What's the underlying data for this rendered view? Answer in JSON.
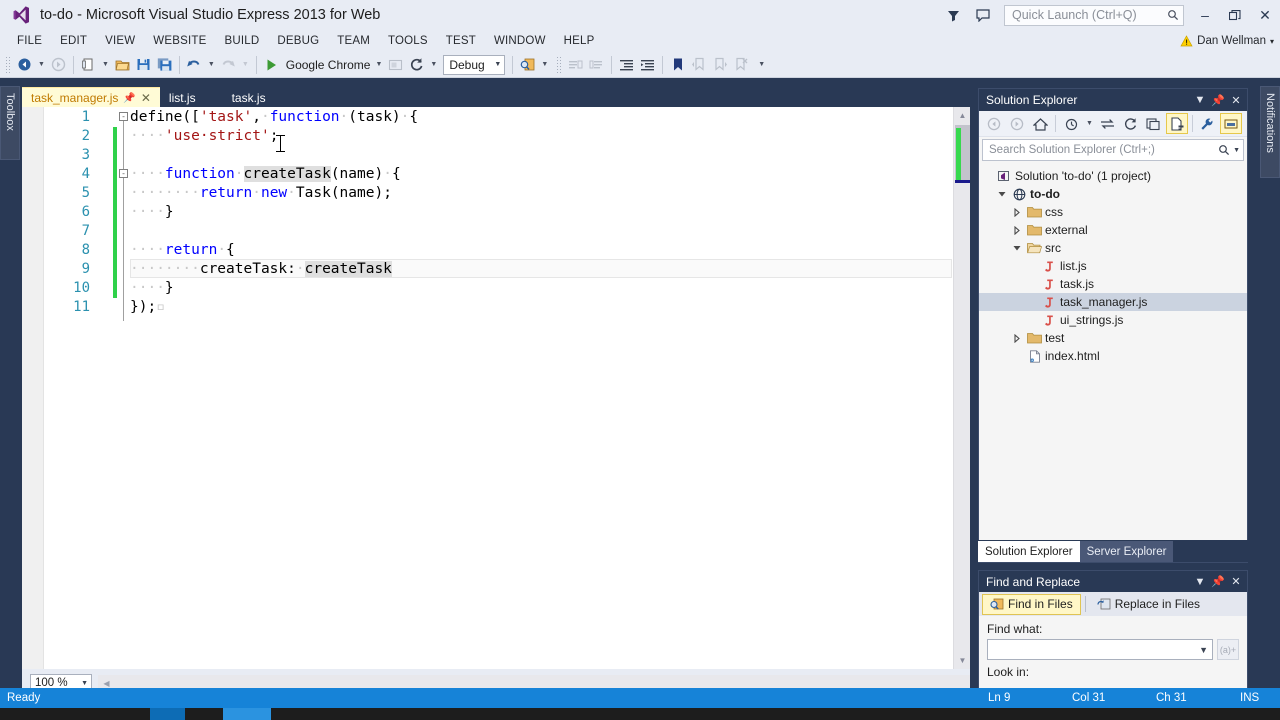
{
  "titlebar": {
    "title": "to-do - Microsoft Visual Studio Express 2013 for Web",
    "logo_icon": "visual-studio-logo",
    "feedback_icon": "feedback-funnel-icon",
    "comment_icon": "comment-icon",
    "quick_launch_placeholder": "Quick Launch (Ctrl+Q)",
    "search_icon": "search-icon",
    "minimize": "–",
    "maximize": "❐",
    "close": "✕"
  },
  "menubar": {
    "items": [
      {
        "label": "FILE"
      },
      {
        "label": "EDIT"
      },
      {
        "label": "VIEW"
      },
      {
        "label": "WEBSITE"
      },
      {
        "label": "BUILD"
      },
      {
        "label": "DEBUG"
      },
      {
        "label": "TEAM"
      },
      {
        "label": "TOOLS"
      },
      {
        "label": "TEST"
      },
      {
        "label": "WINDOW"
      },
      {
        "label": "HELP"
      }
    ],
    "user": {
      "name": "Dan Wellman",
      "warning_icon": "warning-triangle-icon",
      "caret": "▾"
    }
  },
  "toolbar": {
    "navigate_back_icon": "navigate-back-icon",
    "navigate_forward_icon": "navigate-forward-icon",
    "new_item_icon": "new-item-icon",
    "open_file_icon": "open-file-icon",
    "save_icon": "save-icon",
    "save_all_icon": "save-all-icon",
    "undo_icon": "undo-icon",
    "redo_icon": "redo-icon",
    "start_debug_icon": "play-icon",
    "start_label": "Google Chrome",
    "browser_picker_icon": "browser-picker-icon",
    "refresh_icon": "refresh-linked-icon",
    "config": "Debug",
    "find_icon": "find-in-files-icon",
    "comment_out_icon": "comment-out-icon",
    "uncomment_icon": "uncomment-icon",
    "indent_icon": "increase-indent-icon",
    "outdent_icon": "decrease-indent-icon",
    "bookmark_icon": "bookmark-icon",
    "prev_bookmark_icon": "previous-bookmark-icon",
    "next_bookmark_icon": "next-bookmark-icon",
    "clear_bookmarks_icon": "clear-bookmarks-icon",
    "overflow": "⮟"
  },
  "left_dock": {
    "toolbox_label": "Toolbox"
  },
  "right_dock": {
    "notifications_label": "Notifications"
  },
  "editor": {
    "tabs": [
      {
        "label": "task_manager.js",
        "active": true,
        "pin_icon": "pin-icon",
        "close_icon": "close-icon"
      },
      {
        "label": "list.js",
        "active": false
      },
      {
        "label": "task.js",
        "active": false
      }
    ],
    "zoom": "100 %",
    "zoom_caret": "▾",
    "lines": [
      {
        "num": "1",
        "fold": "-",
        "changed": false,
        "current": false,
        "tokens": [
          {
            "t": "define([",
            "c": "plain"
          },
          {
            "t": "'task'",
            "c": "str"
          },
          {
            "t": ",",
            "c": "plain"
          },
          {
            "t": "·",
            "c": "ws"
          },
          {
            "t": "function",
            "c": "kw"
          },
          {
            "t": "·",
            "c": "ws"
          },
          {
            "t": "(task)",
            "c": "plain"
          },
          {
            "t": "·",
            "c": "ws"
          },
          {
            "t": "{",
            "c": "plain"
          }
        ]
      },
      {
        "num": "2",
        "fold": "",
        "changed": true,
        "current": false,
        "tokens": [
          {
            "t": "····",
            "c": "ws"
          },
          {
            "t": "'use·strict'",
            "c": "str"
          },
          {
            "t": ";",
            "c": "plain"
          }
        ]
      },
      {
        "num": "3",
        "fold": "",
        "changed": true,
        "current": false,
        "tokens": []
      },
      {
        "num": "4",
        "fold": "-",
        "changed": true,
        "current": false,
        "tokens": [
          {
            "t": "····",
            "c": "ws"
          },
          {
            "t": "function",
            "c": "kw"
          },
          {
            "t": "·",
            "c": "ws"
          },
          {
            "t": "createTask",
            "c": "hl"
          },
          {
            "t": "(name)",
            "c": "plain"
          },
          {
            "t": "·",
            "c": "ws"
          },
          {
            "t": "{",
            "c": "plain"
          }
        ]
      },
      {
        "num": "5",
        "fold": "",
        "changed": true,
        "current": false,
        "tokens": [
          {
            "t": "········",
            "c": "ws"
          },
          {
            "t": "return",
            "c": "kw"
          },
          {
            "t": "·",
            "c": "ws"
          },
          {
            "t": "new",
            "c": "kw"
          },
          {
            "t": "·",
            "c": "ws"
          },
          {
            "t": "Task(name);",
            "c": "plain"
          }
        ]
      },
      {
        "num": "6",
        "fold": "",
        "changed": true,
        "current": false,
        "tokens": [
          {
            "t": "····",
            "c": "ws"
          },
          {
            "t": "}",
            "c": "plain"
          }
        ]
      },
      {
        "num": "7",
        "fold": "",
        "changed": true,
        "current": false,
        "tokens": []
      },
      {
        "num": "8",
        "fold": "",
        "changed": true,
        "current": false,
        "tokens": [
          {
            "t": "····",
            "c": "ws"
          },
          {
            "t": "return",
            "c": "kw"
          },
          {
            "t": "·",
            "c": "ws"
          },
          {
            "t": "{",
            "c": "plain"
          }
        ]
      },
      {
        "num": "9",
        "fold": "",
        "changed": true,
        "current": true,
        "tokens": [
          {
            "t": "········",
            "c": "ws"
          },
          {
            "t": "createTask:",
            "c": "plain"
          },
          {
            "t": "·",
            "c": "ws"
          },
          {
            "t": "createTask",
            "c": "hl"
          }
        ]
      },
      {
        "num": "10",
        "fold": "",
        "changed": true,
        "current": false,
        "tokens": [
          {
            "t": "····",
            "c": "ws"
          },
          {
            "t": "}",
            "c": "plain"
          }
        ]
      },
      {
        "num": "11",
        "fold": "",
        "changed": false,
        "current": false,
        "tokens": [
          {
            "t": "});",
            "c": "plain"
          },
          {
            "t": "▫",
            "c": "ws"
          }
        ]
      }
    ]
  },
  "solution_explorer": {
    "title": "Solution Explorer",
    "dropdown_icon": "chevron-down-icon",
    "pin_icon": "pin-icon",
    "close_icon": "close-icon",
    "toolbar_icons": [
      "back-icon",
      "forward-icon",
      "home-icon",
      "pending-changes-icon",
      "sync-with-active-document-icon",
      "refresh-icon",
      "collapse-all-icon",
      "show-all-files-icon",
      "properties-icon",
      "preview-selected-items-icon"
    ],
    "search_placeholder": "Search Solution Explorer (Ctrl+;)",
    "search_icon": "search-icon",
    "search_caret": "▾",
    "tree": [
      {
        "label": "Solution 'to-do' (1 project)",
        "icon": "solution-icon",
        "indent": 0,
        "expander": "",
        "bold": false,
        "selected": false
      },
      {
        "label": "to-do",
        "icon": "web-project-icon",
        "indent": 1,
        "expander": "expanded",
        "bold": true,
        "selected": false
      },
      {
        "label": "css",
        "icon": "folder-icon",
        "indent": 2,
        "expander": "collapsed",
        "bold": false,
        "selected": false
      },
      {
        "label": "external",
        "icon": "folder-icon",
        "indent": 2,
        "expander": "collapsed",
        "bold": false,
        "selected": false
      },
      {
        "label": "src",
        "icon": "folder-open-icon",
        "indent": 2,
        "expander": "expanded",
        "bold": false,
        "selected": false
      },
      {
        "label": "list.js",
        "icon": "js-file-icon",
        "indent": 3,
        "expander": "",
        "bold": false,
        "selected": false
      },
      {
        "label": "task.js",
        "icon": "js-file-icon",
        "indent": 3,
        "expander": "",
        "bold": false,
        "selected": false
      },
      {
        "label": "task_manager.js",
        "icon": "js-file-icon",
        "indent": 3,
        "expander": "",
        "bold": false,
        "selected": true
      },
      {
        "label": "ui_strings.js",
        "icon": "js-file-icon",
        "indent": 3,
        "expander": "",
        "bold": false,
        "selected": false
      },
      {
        "label": "test",
        "icon": "folder-icon",
        "indent": 2,
        "expander": "collapsed",
        "bold": false,
        "selected": false
      },
      {
        "label": "index.html",
        "icon": "html-file-icon",
        "indent": 2,
        "expander": "",
        "bold": false,
        "selected": false
      }
    ],
    "bottom_tabs": [
      {
        "label": "Solution Explorer",
        "active": true
      },
      {
        "label": "Server Explorer",
        "active": false
      }
    ]
  },
  "find_and_replace": {
    "title": "Find and Replace",
    "dropdown_icon": "chevron-down-icon",
    "pin_icon": "pin-icon",
    "close_icon": "close-icon",
    "tabs": [
      {
        "label": "Find in Files",
        "icon": "find-in-files-icon",
        "active": true
      },
      {
        "label": "Replace in Files",
        "icon": "replace-in-files-icon",
        "active": false
      }
    ],
    "find_what_label": "Find what:",
    "find_what_value": "",
    "find_what_caret": "∨",
    "regex_button": "(a)+",
    "look_in_label": "Look in:"
  },
  "statusbar": {
    "ready": "Ready",
    "line": "Ln 9",
    "col": "Col 31",
    "ch": "Ch 31",
    "insert_mode": "INS"
  }
}
